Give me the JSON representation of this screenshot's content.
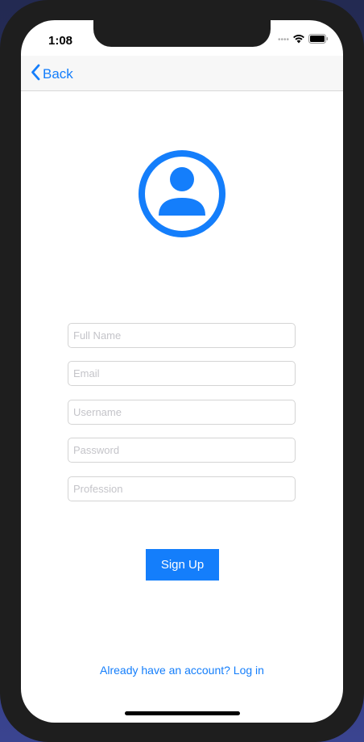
{
  "status_bar": {
    "time": "1:08",
    "signal_icon": "signal-dots-icon",
    "wifi_icon": "wifi-icon",
    "battery_icon": "battery-icon"
  },
  "navbar": {
    "back_label": "Back",
    "back_icon": "chevron-left-icon"
  },
  "avatar": {
    "icon": "user-circle-icon",
    "color": "#147efb"
  },
  "form": {
    "full_name_placeholder": "Full Name",
    "email_placeholder": "Email",
    "username_placeholder": "Username",
    "password_placeholder": "Password",
    "profession_placeholder": "Profession",
    "signup_label": "Sign Up"
  },
  "footer": {
    "login_link": "Already have an account? Log in"
  },
  "colors": {
    "accent": "#147efb"
  }
}
